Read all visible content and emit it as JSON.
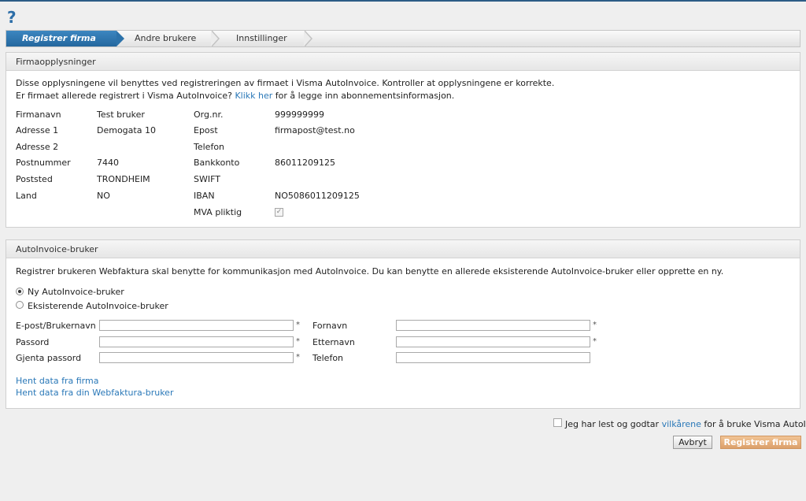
{
  "help_icon": "?",
  "wizard": {
    "steps": [
      "Registrer firma",
      "Andre brukere",
      "Innstillinger"
    ]
  },
  "company": {
    "title": "Firmaopplysninger",
    "intro_line1": "Disse opplysningene vil benyttes ved registreringen av firmaet i Visma AutoInvoice. Kontroller at opplysningene er korrekte.",
    "intro_line2_prefix": "Er firmaet allerede registrert i Visma AutoInvoice?",
    "intro_link": "Klikk her",
    "intro_line2_suffix": "for å legge inn abonnementsinformasjon.",
    "left_fields": [
      {
        "label": "Firmanavn",
        "value": "Test bruker"
      },
      {
        "label": "Adresse 1",
        "value": "Demogata 10"
      },
      {
        "label": "Adresse 2",
        "value": ""
      },
      {
        "label": "Postnummer",
        "value": "7440"
      },
      {
        "label": "Poststed",
        "value": "TRONDHEIM"
      },
      {
        "label": "Land",
        "value": "NO"
      }
    ],
    "right_fields": [
      {
        "label": "Org.nr.",
        "value": "999999999"
      },
      {
        "label": "Epost",
        "value": "firmapost@test.no"
      },
      {
        "label": "Telefon",
        "value": ""
      },
      {
        "label": "Bankkonto",
        "value": "86011209125"
      },
      {
        "label": "SWIFT",
        "value": ""
      },
      {
        "label": "IBAN",
        "value": "NO5086011209125"
      }
    ],
    "vat_label": "MVA pliktig",
    "vat_checked": true
  },
  "user": {
    "title": "AutoInvoice-bruker",
    "intro": "Registrer brukeren Webfaktura skal benytte for kommunikasjon med AutoInvoice. Du kan benytte en allerede eksisterende AutoInvoice-bruker eller opprette en ny.",
    "radio_new": "Ny AutoInvoice-bruker",
    "radio_existing": "Eksisterende AutoInvoice-bruker",
    "selected": "new",
    "left_inputs": [
      {
        "label": "E-post/Brukernavn",
        "value": "",
        "required": "*"
      },
      {
        "label": "Passord",
        "value": "",
        "required": "*"
      },
      {
        "label": "Gjenta passord",
        "value": "",
        "required": "*"
      }
    ],
    "right_inputs": [
      {
        "label": "Fornavn",
        "value": "",
        "required": "*"
      },
      {
        "label": "Etternavn",
        "value": "",
        "required": "*"
      },
      {
        "label": "Telefon",
        "value": "",
        "required": ""
      }
    ],
    "link_company": "Hent data fra firma",
    "link_webfaktura": "Hent data fra din Webfaktura-bruker"
  },
  "terms": {
    "prefix": "Jeg har lest og godtar",
    "link": "vilkårene",
    "suffix": "for å bruke Visma AutoInvoice.",
    "checked": false
  },
  "buttons": {
    "cancel": "Avbryt",
    "register": "Registrer firma"
  },
  "colors": {
    "accent": "#2c72aa",
    "link": "#2a78b8",
    "primary_button": "#e0a874"
  }
}
